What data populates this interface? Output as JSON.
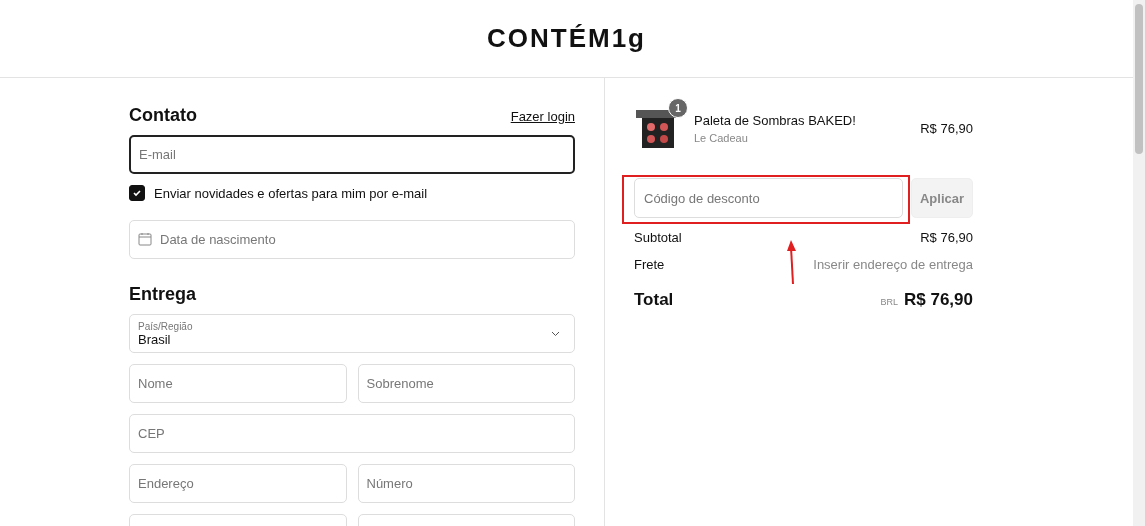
{
  "header": {
    "logo": "CONTÉM1g"
  },
  "contact": {
    "title": "Contato",
    "login_link": "Fazer login",
    "email": {
      "placeholder": "E-mail",
      "focused": true
    },
    "newsletter": {
      "label": "Enviar novidades e ofertas para mim por e-mail",
      "checked": true
    },
    "birthdate": {
      "placeholder": "Data de nascimento"
    }
  },
  "delivery": {
    "title": "Entrega",
    "country": {
      "label": "País/Região",
      "value": "Brasil"
    },
    "rows": [
      [
        {
          "placeholder": "Nome"
        },
        {
          "placeholder": "Sobrenome"
        }
      ],
      [
        {
          "placeholder": "CEP"
        }
      ],
      [
        {
          "placeholder": "Endereço"
        },
        {
          "placeholder": "Número"
        }
      ],
      [
        {},
        {}
      ]
    ]
  },
  "summary": {
    "item": {
      "name": "Paleta de Sombras BAKED!",
      "variant": "Le Cadeau",
      "price": "R$ 76,90",
      "quantity": "1"
    },
    "discount": {
      "placeholder": "Código de desconto",
      "button": "Aplicar"
    },
    "lines": [
      {
        "label": "Subtotal",
        "value": "R$ 76,90",
        "muted": false
      },
      {
        "label": "Frete",
        "value": "Inserir endereço de entrega",
        "muted": true
      }
    ],
    "total": {
      "label": "Total",
      "currency": "BRL",
      "value": "R$ 76,90"
    }
  }
}
